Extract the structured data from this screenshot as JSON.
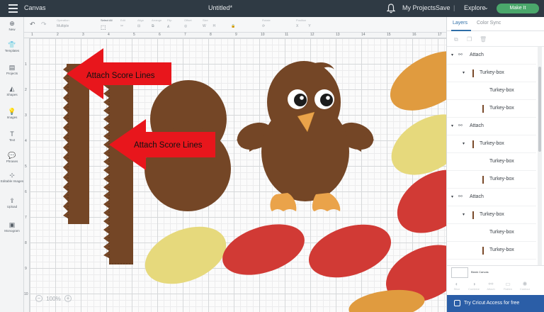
{
  "topbar": {
    "canvas_title": "Canvas",
    "doc_title": "Untitled*",
    "my_projects": "My Projects",
    "save": "Save",
    "explore": "Explore",
    "make_it": "Make It"
  },
  "toolbar": {
    "undo_icon": "undo-icon",
    "redo_icon": "redo-icon",
    "operation_label": "Operation",
    "operation_value": "Multiple",
    "select_all": "Select All",
    "edit": "Edit",
    "align": "Align",
    "arrange": "Arrange",
    "flip": "Flip",
    "offset": "Offset",
    "size": "Size",
    "rotate": "Rotate",
    "position": "Position"
  },
  "leftnav": {
    "items": [
      {
        "label": "New",
        "icon": "plus-icon"
      },
      {
        "label": "Templates",
        "icon": "shirt-icon"
      },
      {
        "label": "Projects",
        "icon": "projects-icon"
      },
      {
        "label": "Shapes",
        "icon": "shapes-icon"
      },
      {
        "label": "Images",
        "icon": "lightbulb-icon"
      },
      {
        "label": "Text",
        "icon": "text-icon"
      },
      {
        "label": "Phrases",
        "icon": "speech-bubble-icon"
      },
      {
        "label": "Editable Images",
        "icon": "editable-images-icon"
      },
      {
        "label": "Upload",
        "icon": "upload-icon"
      },
      {
        "label": "Monogram",
        "icon": "monogram-icon"
      }
    ]
  },
  "rulers": {
    "top": [
      "1",
      "2",
      "3",
      "4",
      "5",
      "6",
      "7",
      "8",
      "9",
      "10",
      "11",
      "12",
      "13",
      "14",
      "15",
      "16",
      "17"
    ],
    "left": [
      "1",
      "2",
      "3",
      "4",
      "5",
      "6",
      "7",
      "8",
      "9",
      "10"
    ]
  },
  "annotations": {
    "arrow1": "Attach Score Lines",
    "arrow2": "Attach Score Lines"
  },
  "colors": {
    "brown": "#744626",
    "orange": "#e1a142",
    "light_orange": "#f4b25a",
    "yellow": "#e6d97c",
    "red": "#d13a35",
    "arrow_red": "#e8161c",
    "accent_blue": "#2b5ea7",
    "make_it_green": "#4aa76b"
  },
  "zoom": {
    "minus": "−",
    "value": "100%",
    "plus": "+"
  },
  "panel": {
    "tabs": [
      "Layers",
      "Color Sync"
    ],
    "layers": [
      {
        "name": "Attach",
        "level": 0
      },
      {
        "name": "Turkey-box",
        "level": 1
      },
      {
        "name": "Turkey-box",
        "level": 2
      },
      {
        "name": "Turkey-box",
        "level": 2
      },
      {
        "name": "Attach",
        "level": 0
      },
      {
        "name": "Turkey-box",
        "level": 1
      },
      {
        "name": "Turkey-box",
        "level": 2
      },
      {
        "name": "Turkey-box",
        "level": 2
      },
      {
        "name": "Attach",
        "level": 0
      },
      {
        "name": "Turkey-box",
        "level": 1
      },
      {
        "name": "Turkey-box",
        "level": 2
      },
      {
        "name": "Turkey-box",
        "level": 2
      }
    ],
    "blank_canvas": "Blank Canvas",
    "bottom_actions": [
      "Slice",
      "Combine",
      "Attach",
      "Flatten",
      "Contour"
    ],
    "access": "Try Cricut Access for free"
  }
}
